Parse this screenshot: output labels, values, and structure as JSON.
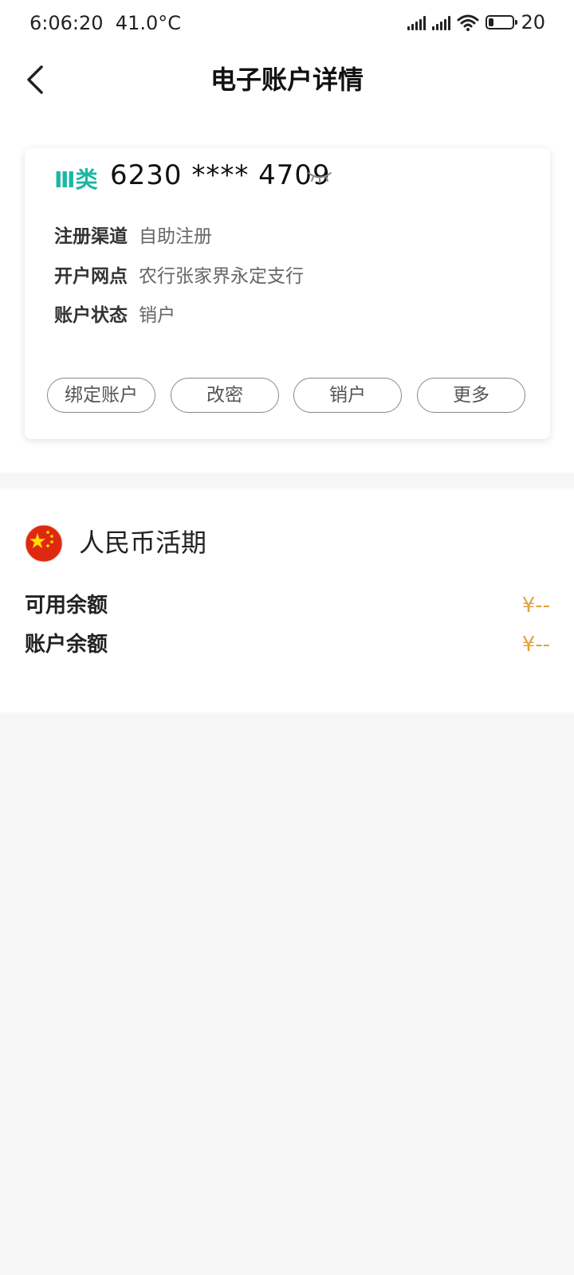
{
  "status_bar": {
    "time": "6:06:20",
    "temperature": "41.0°C",
    "battery_level": "20",
    "icons": [
      "signal-icon",
      "signal-icon",
      "wifi-icon",
      "battery-icon"
    ]
  },
  "nav": {
    "title": "电子账户详情",
    "back_icon": "chevron-left-icon"
  },
  "account_card": {
    "type_label": "Ⅲ类",
    "number": "6230 **** 4709",
    "visibility_icon": "eye-closed-icon",
    "info": [
      {
        "label": "注册渠道",
        "value": "自助注册"
      },
      {
        "label": "开户网点",
        "value": "农行张家界永定支行"
      },
      {
        "label": "账户状态",
        "value": "销户"
      }
    ],
    "actions": [
      {
        "label": "绑定账户"
      },
      {
        "label": "改密"
      },
      {
        "label": "销户"
      },
      {
        "label": "更多"
      }
    ]
  },
  "balance": {
    "flag_icon": "china-flag-icon",
    "currency_name": "人民币活期",
    "rows": [
      {
        "label": "可用余额",
        "value": "¥--"
      },
      {
        "label": "账户余额",
        "value": "¥--"
      }
    ]
  },
  "colors": {
    "accent_teal": "#19b7a4",
    "amount_orange": "#e3a13b",
    "background": "#f6f6f6"
  }
}
